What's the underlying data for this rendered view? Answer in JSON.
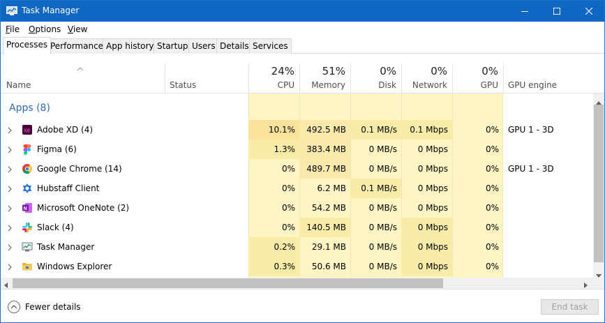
{
  "window": {
    "title": "Task Manager"
  },
  "menu": [
    {
      "label": "File",
      "ul": "F",
      "rest": "ile"
    },
    {
      "label": "Options",
      "ul": "O",
      "rest": "ptions"
    },
    {
      "label": "View",
      "ul": "V",
      "rest": "iew"
    }
  ],
  "tabs": [
    "Processes",
    "Performance",
    "App history",
    "Startup",
    "Users",
    "Details",
    "Services"
  ],
  "columns": {
    "name": "Name",
    "status": "Status",
    "cpu": {
      "pct": "24%",
      "label": "CPU"
    },
    "memory": {
      "pct": "51%",
      "label": "Memory"
    },
    "disk": {
      "pct": "0%",
      "label": "Disk"
    },
    "network": {
      "pct": "0%",
      "label": "Network"
    },
    "gpu": {
      "pct": "0%",
      "label": "GPU"
    },
    "gpu_engine": "GPU engine"
  },
  "group": {
    "label": "Apps (8)"
  },
  "processes": [
    {
      "name": "Adobe XD (4)",
      "icon": "adobe-xd-icon",
      "cpu": "10.1%",
      "memory": "492.5 MB",
      "disk": "0.1 MB/s",
      "network": "0.1 Mbps",
      "gpu": "0%",
      "gpu_engine": "GPU 1 - 3D"
    },
    {
      "name": "Figma (6)",
      "icon": "figma-icon",
      "cpu": "1.3%",
      "memory": "383.4 MB",
      "disk": "0 MB/s",
      "network": "0 Mbps",
      "gpu": "0%",
      "gpu_engine": ""
    },
    {
      "name": "Google Chrome (14)",
      "icon": "chrome-icon",
      "cpu": "0%",
      "memory": "489.7 MB",
      "disk": "0 MB/s",
      "network": "0 Mbps",
      "gpu": "0%",
      "gpu_engine": "GPU 1 - 3D"
    },
    {
      "name": "Hubstaff Client",
      "icon": "hubstaff-icon",
      "cpu": "0%",
      "memory": "6.2 MB",
      "disk": "0.1 MB/s",
      "network": "0 Mbps",
      "gpu": "0%",
      "gpu_engine": ""
    },
    {
      "name": "Microsoft OneNote (2)",
      "icon": "onenote-icon",
      "cpu": "0%",
      "memory": "54.2 MB",
      "disk": "0 MB/s",
      "network": "0 Mbps",
      "gpu": "0%",
      "gpu_engine": ""
    },
    {
      "name": "Slack (4)",
      "icon": "slack-icon",
      "cpu": "0%",
      "memory": "140.5 MB",
      "disk": "0 MB/s",
      "network": "0 Mbps",
      "gpu": "0%",
      "gpu_engine": ""
    },
    {
      "name": "Task Manager",
      "icon": "task-manager-icon",
      "cpu": "0.2%",
      "memory": "29.1 MB",
      "disk": "0 MB/s",
      "network": "0 Mbps",
      "gpu": "0%",
      "gpu_engine": ""
    },
    {
      "name": "Windows Explorer",
      "icon": "file-explorer-icon",
      "cpu": "0.3%",
      "memory": "50.6 MB",
      "disk": "0 MB/s",
      "network": "0 Mbps",
      "gpu": "0%",
      "gpu_engine": ""
    }
  ],
  "footer": {
    "fewer_details": "Fewer details",
    "fewer_ul": "d",
    "end_task": "End task"
  },
  "colors": {
    "titlebar": "#0e67c2",
    "heat_light": "#fff4c4",
    "heat_mid": "#f9eca8",
    "heat_strong": "#f8e29b",
    "group_text": "#2e6ab7"
  }
}
